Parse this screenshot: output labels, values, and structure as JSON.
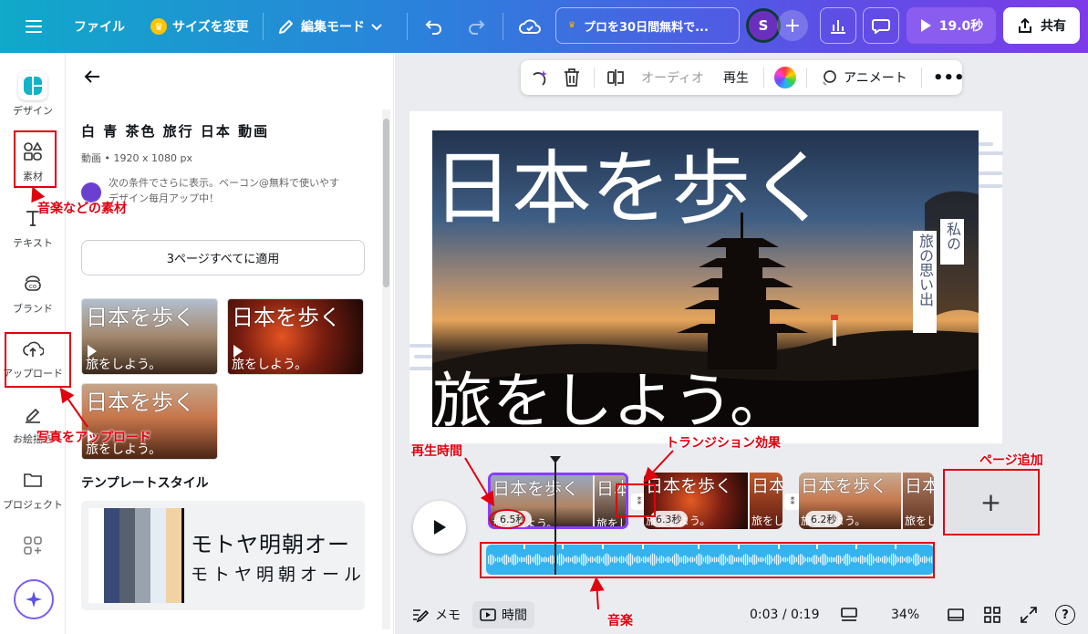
{
  "topbar": {
    "file_label": "ファイル",
    "resize_label": "サイズを変更",
    "edit_mode_label": "編集モード",
    "promo_text": "プロを30日間無料で...",
    "avatar_initial": "S",
    "play_label": "19.0秒",
    "share_label": "共有"
  },
  "rail": {
    "items": [
      {
        "label": "デザイン",
        "icon": "design-icon"
      },
      {
        "label": "素材",
        "icon": "elements-icon"
      },
      {
        "label": "テキスト",
        "icon": "text-icon"
      },
      {
        "label": "ブランド",
        "icon": "brand-icon"
      },
      {
        "label": "アップロード",
        "icon": "upload-icon"
      },
      {
        "label": "お絵描き",
        "icon": "draw-icon"
      },
      {
        "label": "プロジェクト",
        "icon": "folder-icon"
      }
    ]
  },
  "panel": {
    "title": "白 青 茶色 旅行 日本 動画",
    "meta": "動画 • 1920 x 1080 px",
    "author_line1": "次の条件でさらに表示。ベーコン@無料で使いやす",
    "author_line2": "デザイン毎月アップ中！",
    "apply_button": "3ページすべてに適用",
    "thumbs": [
      {
        "top": "日本を歩く",
        "bottom": "旅をしよう。"
      },
      {
        "top": "日本を歩く",
        "bottom": "旅をしよう。"
      },
      {
        "top": "日本を歩く",
        "bottom": "旅をしよう。"
      }
    ],
    "style_heading": "テンプレートスタイル",
    "style_font_1": "モトヤ明朝オー",
    "style_font_2": "モトヤ明朝オール",
    "palette": [
      "#ffffff",
      "#3a4a78",
      "#56606e",
      "#9aa3ad",
      "#e6ecf3",
      "#f0d2a3",
      "#19100c"
    ]
  },
  "toolbar": {
    "audio_label": "オーディオ",
    "playback_label": "再生",
    "animate_label": "アニメート"
  },
  "slide": {
    "title": "日本を歩く",
    "subtitle": "旅をしよう。",
    "vertical_1": "私の",
    "vertical_2": "旅の思い出"
  },
  "timeline": {
    "clips": [
      {
        "duration": "6.5秒",
        "top": "日本を歩く",
        "bottom": "旅をしよう。"
      },
      {
        "duration": "6.3秒",
        "top": "日本を歩く",
        "bottom": "旅をしよう。"
      },
      {
        "duration": "6.2秒",
        "top": "日本を歩く",
        "bottom": "旅をしよう。"
      }
    ],
    "add_page_symbol": "+"
  },
  "bottombar": {
    "notes_label": "メモ",
    "time_label": "時間",
    "time_readout": "0:03 / 0:19",
    "zoom": "34%",
    "help": "?"
  },
  "annotations": {
    "materials": "音楽などの素材",
    "upload": "写真をアップロード",
    "playtime": "再生時間",
    "transition": "トランジション効果",
    "add_page": "ページ追加",
    "music": "音楽"
  },
  "colors": {
    "accent_purple": "#8b3dff",
    "annotation_red": "#e0000e",
    "audio_blue": "#34b3ee"
  }
}
